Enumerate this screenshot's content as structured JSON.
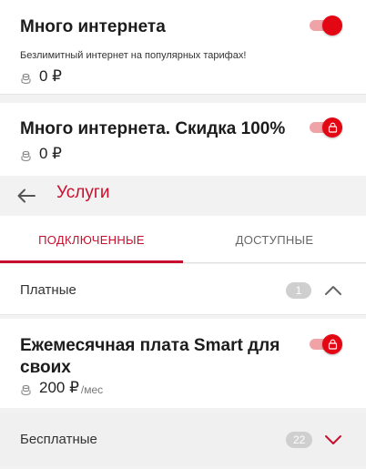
{
  "services_top": [
    {
      "title": "Много интернета",
      "description": "Безлимитный интернет на популярных тарифах!",
      "price": "0 ₽",
      "toggle_on": true,
      "locked": false
    },
    {
      "title": "Много интернета. Скидка 100%",
      "price": "0 ₽",
      "toggle_on": true,
      "locked": true
    }
  ],
  "header": {
    "title": "Услуги",
    "back_icon": "arrow-left-icon"
  },
  "tabs": [
    {
      "label": "ПОДКЛЮЧЕННЫЕ",
      "active": true
    },
    {
      "label": "ДОСТУПНЫЕ",
      "active": false
    }
  ],
  "sections": {
    "paid": {
      "label": "Платные",
      "count": "1",
      "expanded": true,
      "items": [
        {
          "title": "Ежемесячная плата Smart для своих",
          "price": "200 ₽",
          "unit": "/мес",
          "toggle_on": true,
          "locked": true
        }
      ]
    },
    "free": {
      "label": "Бесплатные",
      "count": "22",
      "expanded": false
    }
  },
  "colors": {
    "accent": "#c8102e",
    "toggle_knob": "#e30613",
    "toggle_track": "#f0a3a6",
    "badge": "#cfcfcf",
    "background": "#f2f2f2"
  }
}
